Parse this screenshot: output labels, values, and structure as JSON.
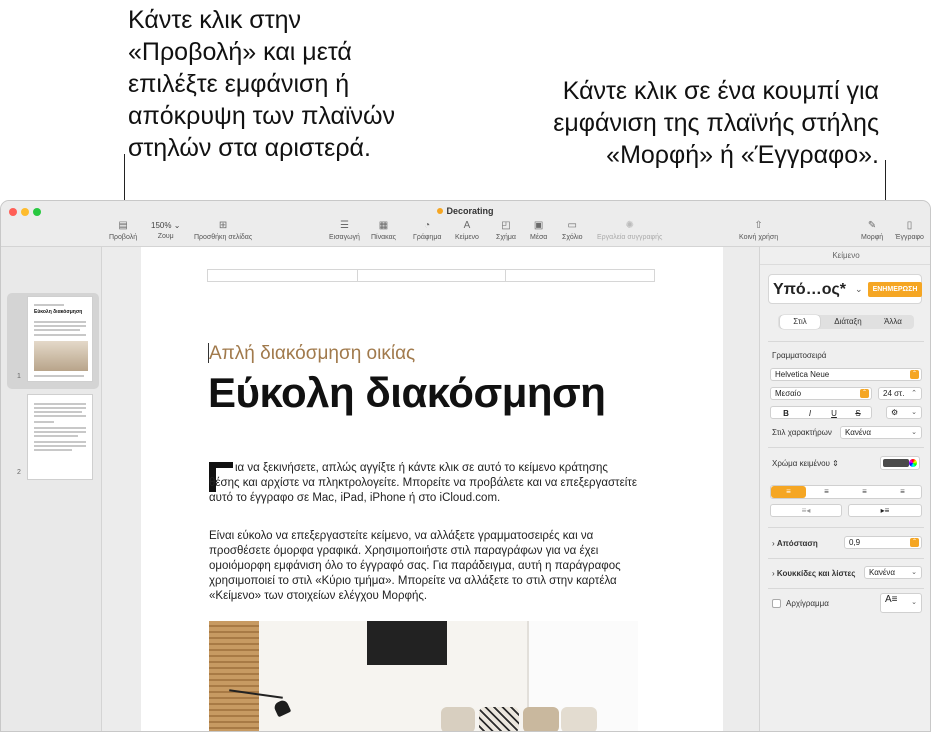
{
  "callouts": {
    "left": "Κάντε κλικ στην\n«Προβολή» και μετά\nεπιλέξτε εμφάνιση ή\nαπόκρυψη των πλαϊνών\nστηλών στα αριστερά.",
    "right": "Κάντε κλικ σε ένα κουμπί για\nεμφάνιση της πλαϊνής στήλης\n«Μορφή» ή «Έγγραφο»."
  },
  "window": {
    "title": "Decorating",
    "traffic_light_colors": [
      "#ff5f57",
      "#febc2e",
      "#28c840"
    ]
  },
  "toolbar": {
    "view": "Προβολή",
    "zoom_value": "150%",
    "zoom": "Ζουμ",
    "add_page": "Προσθήκη σελίδας",
    "insert": "Εισαγωγή",
    "table": "Πίνακας",
    "chart": "Γράφημα",
    "text": "Κείμενο",
    "shape": "Σχήμα",
    "media": "Μέσα",
    "comment": "Σχόλιο",
    "writing_tools": "Εργαλεία συγγραφής",
    "share": "Κοινή χρήση",
    "format": "Μορφή",
    "document": "Έγγραφο"
  },
  "pages": [
    {
      "number": "1",
      "title": "Εύκολη διακόσμηση"
    },
    {
      "number": "2"
    }
  ],
  "document": {
    "subtitle": "Απλή διακόσμηση οικίας",
    "heading": "Εύκολη διακόσμηση",
    "para1": "ια να ξεκινήσετε, απλώς αγγίξτε ή κάντε κλικ σε αυτό το κείμενο κράτησης θέσης και αρχίστε να πληκτρολογείτε. Μπορείτε να προβάλετε και να επεξεργαστείτε αυτό το έγγραφο σε Mac, iPad, iPhone ή στο iCloud.com.",
    "para2": "Είναι εύκολο να επεξεργαστείτε κείμενο, να αλλάξετε γραμματοσειρές και να προσθέσετε όμορφα γραφικά. Χρησιμοποιήστε στιλ παραγράφων για να έχει ομοιόμορφη εμφάνιση όλο το έγγραφό σας. Για παράδειγμα, αυτή η παράγραφος χρησιμοποιεί το στιλ «Κύριο τμήμα». Μπορείτε να αλλάξετε το στιλ στην καρτέλα «Κείμενο» των στοιχείων ελέγχου Μορφής."
  },
  "inspector": {
    "header": "Κείμενο",
    "style_name": "Υπό…ος*",
    "update_button": "ΕΝΗΜΕΡΩΣΗ",
    "tabs": [
      "Στιλ",
      "Διάταξη",
      "Άλλα"
    ],
    "font_section": "Γραμματοσειρά",
    "font_family": "Helvetica Neue",
    "font_weight": "Μεσαίο",
    "font_size": "24 στ.",
    "format_buttons": [
      "B",
      "I",
      "U",
      "S"
    ],
    "char_styles_label": "Στιλ χαρακτήρων",
    "char_styles_value": "Κανένα",
    "text_color_label": "Χρώμα κειμένου",
    "accent_color": "#f5a623",
    "spacing_label": "Απόσταση",
    "spacing_value": "0,9",
    "bullets_label": "Κουκκίδες και λίστες",
    "bullets_value": "Κανένα",
    "dropcap_label": "Αρχίγραμμα"
  }
}
